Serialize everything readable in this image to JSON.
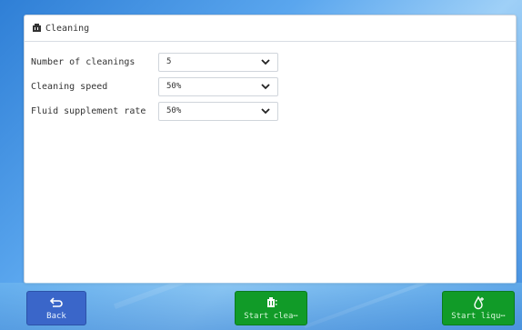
{
  "panel": {
    "title": "Cleaning"
  },
  "fields": [
    {
      "label": "Number of cleanings",
      "value": "5"
    },
    {
      "label": "Cleaning speed",
      "value": "50%"
    },
    {
      "label": "Fluid supplement rate",
      "value": "50%"
    }
  ],
  "buttons": {
    "back": {
      "label": "Back",
      "icon": "back-arrow-icon"
    },
    "start_cleaning": {
      "label": "Start clea⋯",
      "icon": "cleaning-icon"
    },
    "start_liquid": {
      "label": "Start liqu⋯",
      "icon": "droplet-icon"
    }
  },
  "colors": {
    "back": "#3a66c9",
    "green": "#119b28"
  }
}
